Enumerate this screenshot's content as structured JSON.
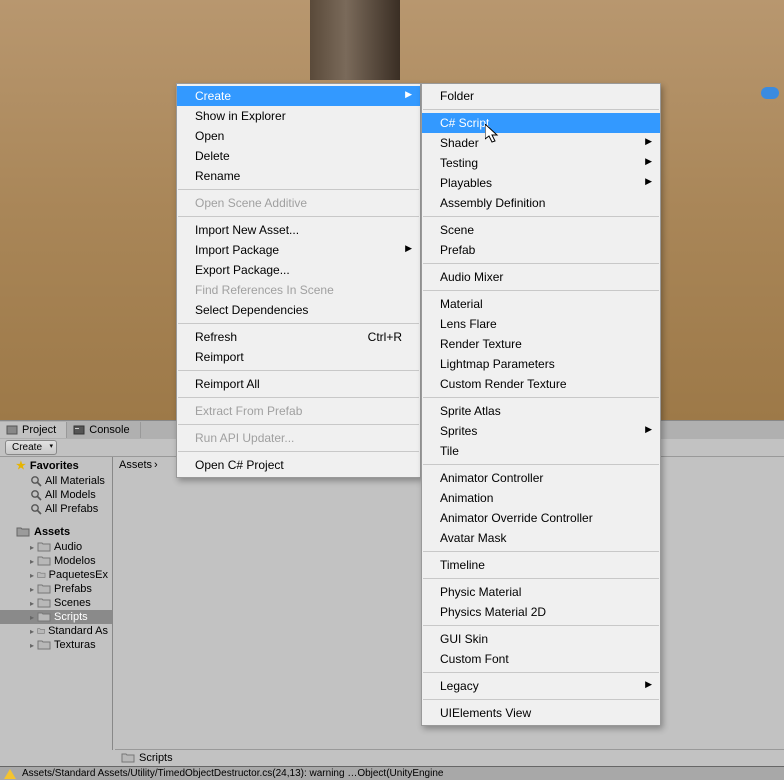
{
  "tabs": {
    "project": "Project",
    "console": "Console"
  },
  "toolbar": {
    "create": "Create"
  },
  "tree": {
    "favorites": "Favorites",
    "fav_items": [
      "All Materials",
      "All Models",
      "All Prefabs"
    ],
    "assets": "Assets",
    "asset_items": [
      "Audio",
      "Modelos",
      "PaquetesEx",
      "Prefabs",
      "Scenes",
      "Scripts",
      "Standard As",
      "Texturas"
    ],
    "selected_index": 5
  },
  "breadcrumb": {
    "root": "Assets",
    "arrow": "›"
  },
  "footer_path": "Scripts",
  "statusbar": "Assets/Standard Assets/Utility/TimedObjectDestructor.cs(24,13): warning …Object(UnityEngine",
  "menu1": [
    {
      "label": "Create",
      "submenu": true,
      "highlighted": true
    },
    {
      "label": "Show in Explorer"
    },
    {
      "label": "Open"
    },
    {
      "label": "Delete"
    },
    {
      "label": "Rename"
    },
    {
      "sep": true
    },
    {
      "label": "Open Scene Additive",
      "disabled": true
    },
    {
      "sep": true
    },
    {
      "label": "Import New Asset..."
    },
    {
      "label": "Import Package",
      "submenu": true
    },
    {
      "label": "Export Package..."
    },
    {
      "label": "Find References In Scene",
      "disabled": true
    },
    {
      "label": "Select Dependencies"
    },
    {
      "sep": true
    },
    {
      "label": "Refresh",
      "shortcut": "Ctrl+R"
    },
    {
      "label": "Reimport"
    },
    {
      "sep": true
    },
    {
      "label": "Reimport All"
    },
    {
      "sep": true
    },
    {
      "label": "Extract From Prefab",
      "disabled": true
    },
    {
      "sep": true
    },
    {
      "label": "Run API Updater...",
      "disabled": true
    },
    {
      "sep": true
    },
    {
      "label": "Open C# Project"
    }
  ],
  "menu2": [
    {
      "label": "Folder"
    },
    {
      "sep": true
    },
    {
      "label": "C# Script",
      "highlighted": true
    },
    {
      "label": "Shader",
      "submenu": true
    },
    {
      "label": "Testing",
      "submenu": true
    },
    {
      "label": "Playables",
      "submenu": true
    },
    {
      "label": "Assembly Definition"
    },
    {
      "sep": true
    },
    {
      "label": "Scene"
    },
    {
      "label": "Prefab"
    },
    {
      "sep": true
    },
    {
      "label": "Audio Mixer"
    },
    {
      "sep": true
    },
    {
      "label": "Material"
    },
    {
      "label": "Lens Flare"
    },
    {
      "label": "Render Texture"
    },
    {
      "label": "Lightmap Parameters"
    },
    {
      "label": "Custom Render Texture"
    },
    {
      "sep": true
    },
    {
      "label": "Sprite Atlas"
    },
    {
      "label": "Sprites",
      "submenu": true
    },
    {
      "label": "Tile"
    },
    {
      "sep": true
    },
    {
      "label": "Animator Controller"
    },
    {
      "label": "Animation"
    },
    {
      "label": "Animator Override Controller"
    },
    {
      "label": "Avatar Mask"
    },
    {
      "sep": true
    },
    {
      "label": "Timeline"
    },
    {
      "sep": true
    },
    {
      "label": "Physic Material"
    },
    {
      "label": "Physics Material 2D"
    },
    {
      "sep": true
    },
    {
      "label": "GUI Skin"
    },
    {
      "label": "Custom Font"
    },
    {
      "sep": true
    },
    {
      "label": "Legacy",
      "submenu": true
    },
    {
      "sep": true
    },
    {
      "label": "UIElements View"
    }
  ]
}
